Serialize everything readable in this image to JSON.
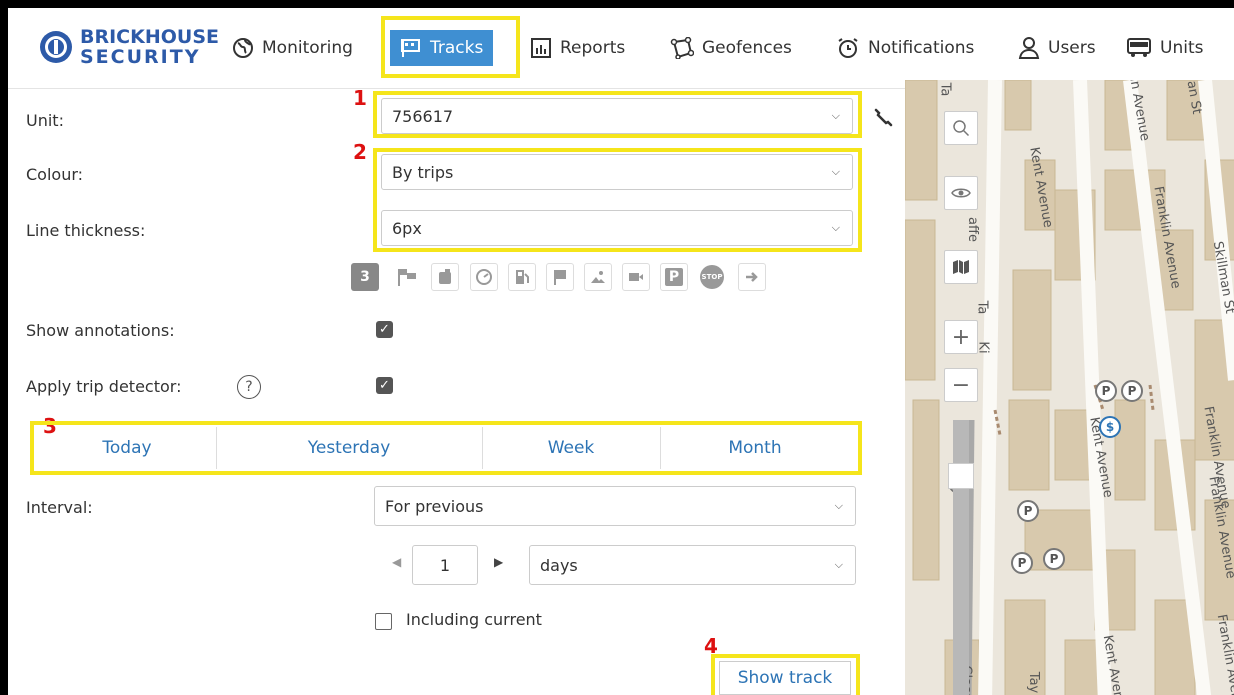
{
  "nav": {
    "logo_line1": "BRICKHOUSE",
    "logo_line2": "SECURITY",
    "items": [
      {
        "label": "Monitoring",
        "icon": "globe-icon"
      },
      {
        "label": "Tracks",
        "icon": "tracks-flag-icon",
        "active": true
      },
      {
        "label": "Reports",
        "icon": "report-chart-icon"
      },
      {
        "label": "Geofences",
        "icon": "geofence-icon"
      },
      {
        "label": "Notifications",
        "icon": "alarm-clock-icon"
      },
      {
        "label": "Users",
        "icon": "user-icon"
      },
      {
        "label": "Units",
        "icon": "bus-icon"
      }
    ],
    "accent": "#3f8fd2"
  },
  "annotations": {
    "n1": "1",
    "n2": "2",
    "n3": "3",
    "n4": "4",
    "highlight_color": "#f5e51b",
    "number_color": "#dd1111"
  },
  "form": {
    "unit_label": "Unit:",
    "unit_value": "756617",
    "colour_label": "Colour:",
    "colour_value": "By trips",
    "thickness_label": "Line thickness:",
    "thickness_value": "6px",
    "show_annotations_label": "Show annotations:",
    "show_annotations_checked": true,
    "trip_detector_label": "Apply trip detector:",
    "trip_detector_help": "?",
    "trip_detector_checked": true,
    "interval_label": "Interval:",
    "interval_value": "For previous",
    "count_value": "1",
    "period_value": "days",
    "including_current_label": "Including current",
    "including_current_checked": false,
    "show_track_label": "Show track"
  },
  "toolbar_icons": [
    {
      "name": "number-3-icon",
      "text": "3"
    },
    {
      "name": "flags-icon"
    },
    {
      "name": "fuel-tank-icon"
    },
    {
      "name": "gauge-icon"
    },
    {
      "name": "fuel-station-icon"
    },
    {
      "name": "flag-icon"
    },
    {
      "name": "image-icon"
    },
    {
      "name": "video-icon"
    },
    {
      "name": "parking-icon",
      "text": "P"
    },
    {
      "name": "stop-icon",
      "text": "STOP"
    },
    {
      "name": "arrow-right-icon"
    }
  ],
  "quick_ranges": [
    "Today",
    "Yesterday",
    "Week",
    "Month"
  ],
  "map": {
    "streets": [
      "Ta",
      "lin Avenue",
      "an St",
      "Kent Avenue",
      "Franklin Avenue",
      "Skillman St",
      "affe",
      "Ta",
      "Ki",
      "Kent Avenue",
      "Franklin Avenue",
      "Franklin Avenue",
      "Kent Aven",
      "Tay",
      "Class",
      "Franklin Aven"
    ],
    "controls": [
      "search-icon",
      "eye-icon",
      "map-layers-icon",
      "zoom-in-icon",
      "zoom-out-icon"
    ],
    "zoom_in": "+",
    "zoom_out": "−",
    "markers": [
      "P",
      "P",
      "$",
      "P",
      "P",
      "P",
      "P"
    ]
  }
}
